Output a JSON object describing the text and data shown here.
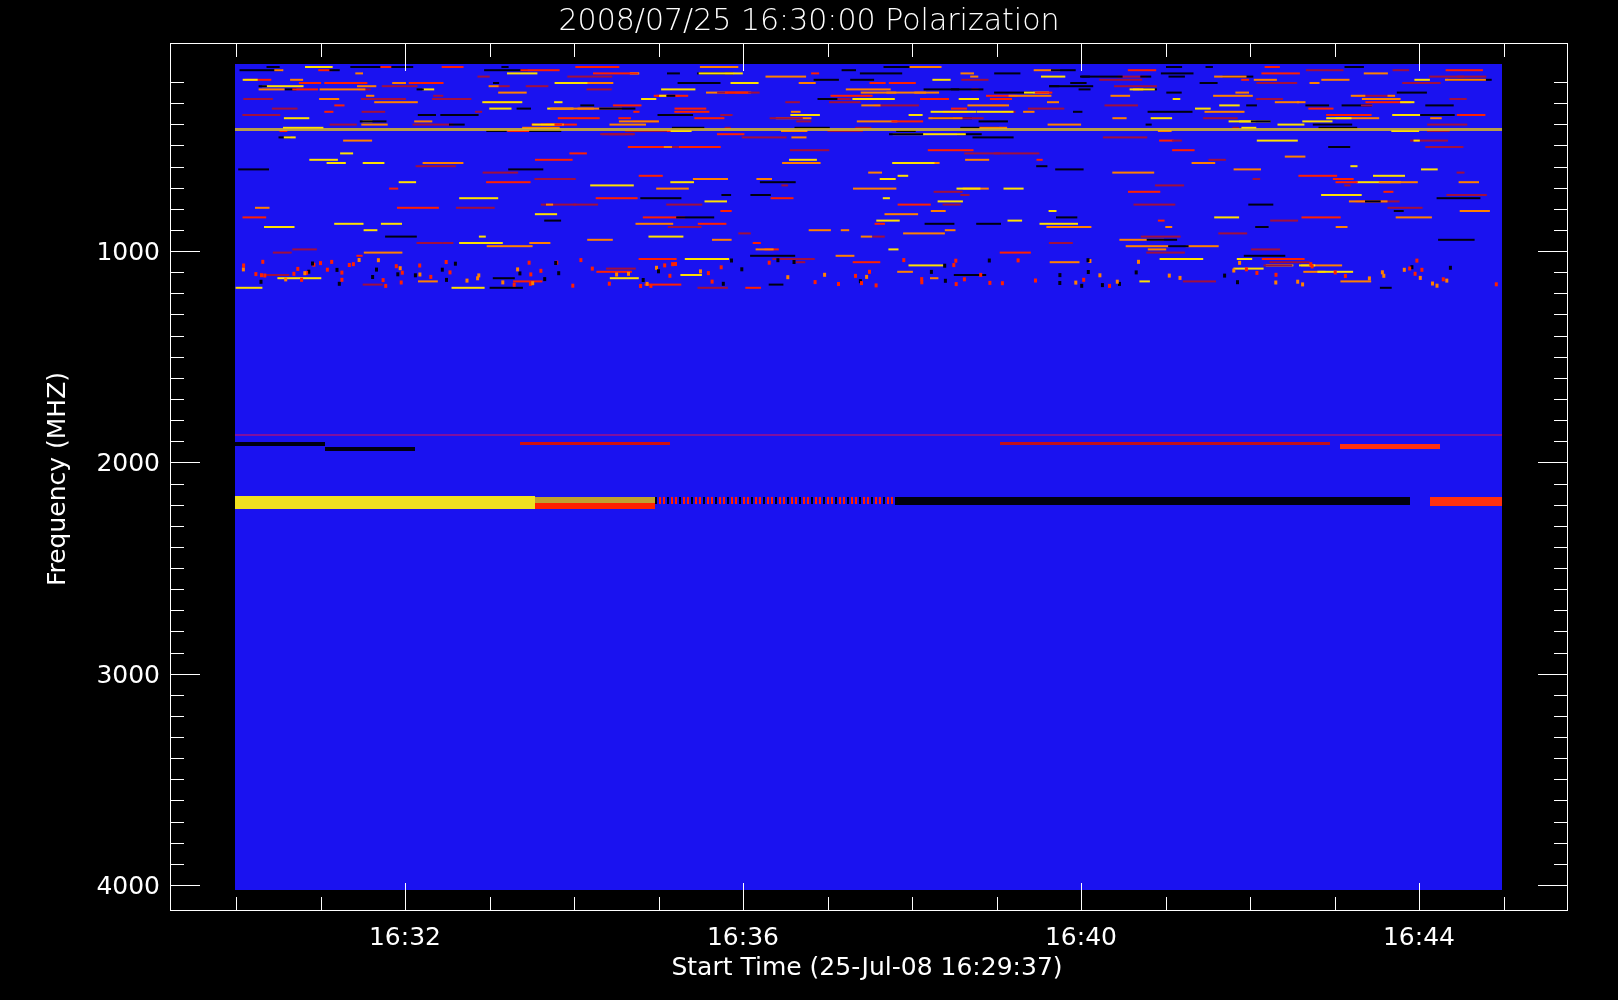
{
  "title": "2008/07/25 16:30:00 Polarization",
  "y_axis": {
    "label": "Frequency (MHZ)",
    "ticks": [
      "1000",
      "2000",
      "3000",
      "4000"
    ]
  },
  "x_axis": {
    "label": "Start Time (25-Jul-08 16:29:37)",
    "ticks": [
      "16:32",
      "16:36",
      "16:40",
      "16:44"
    ]
  }
}
